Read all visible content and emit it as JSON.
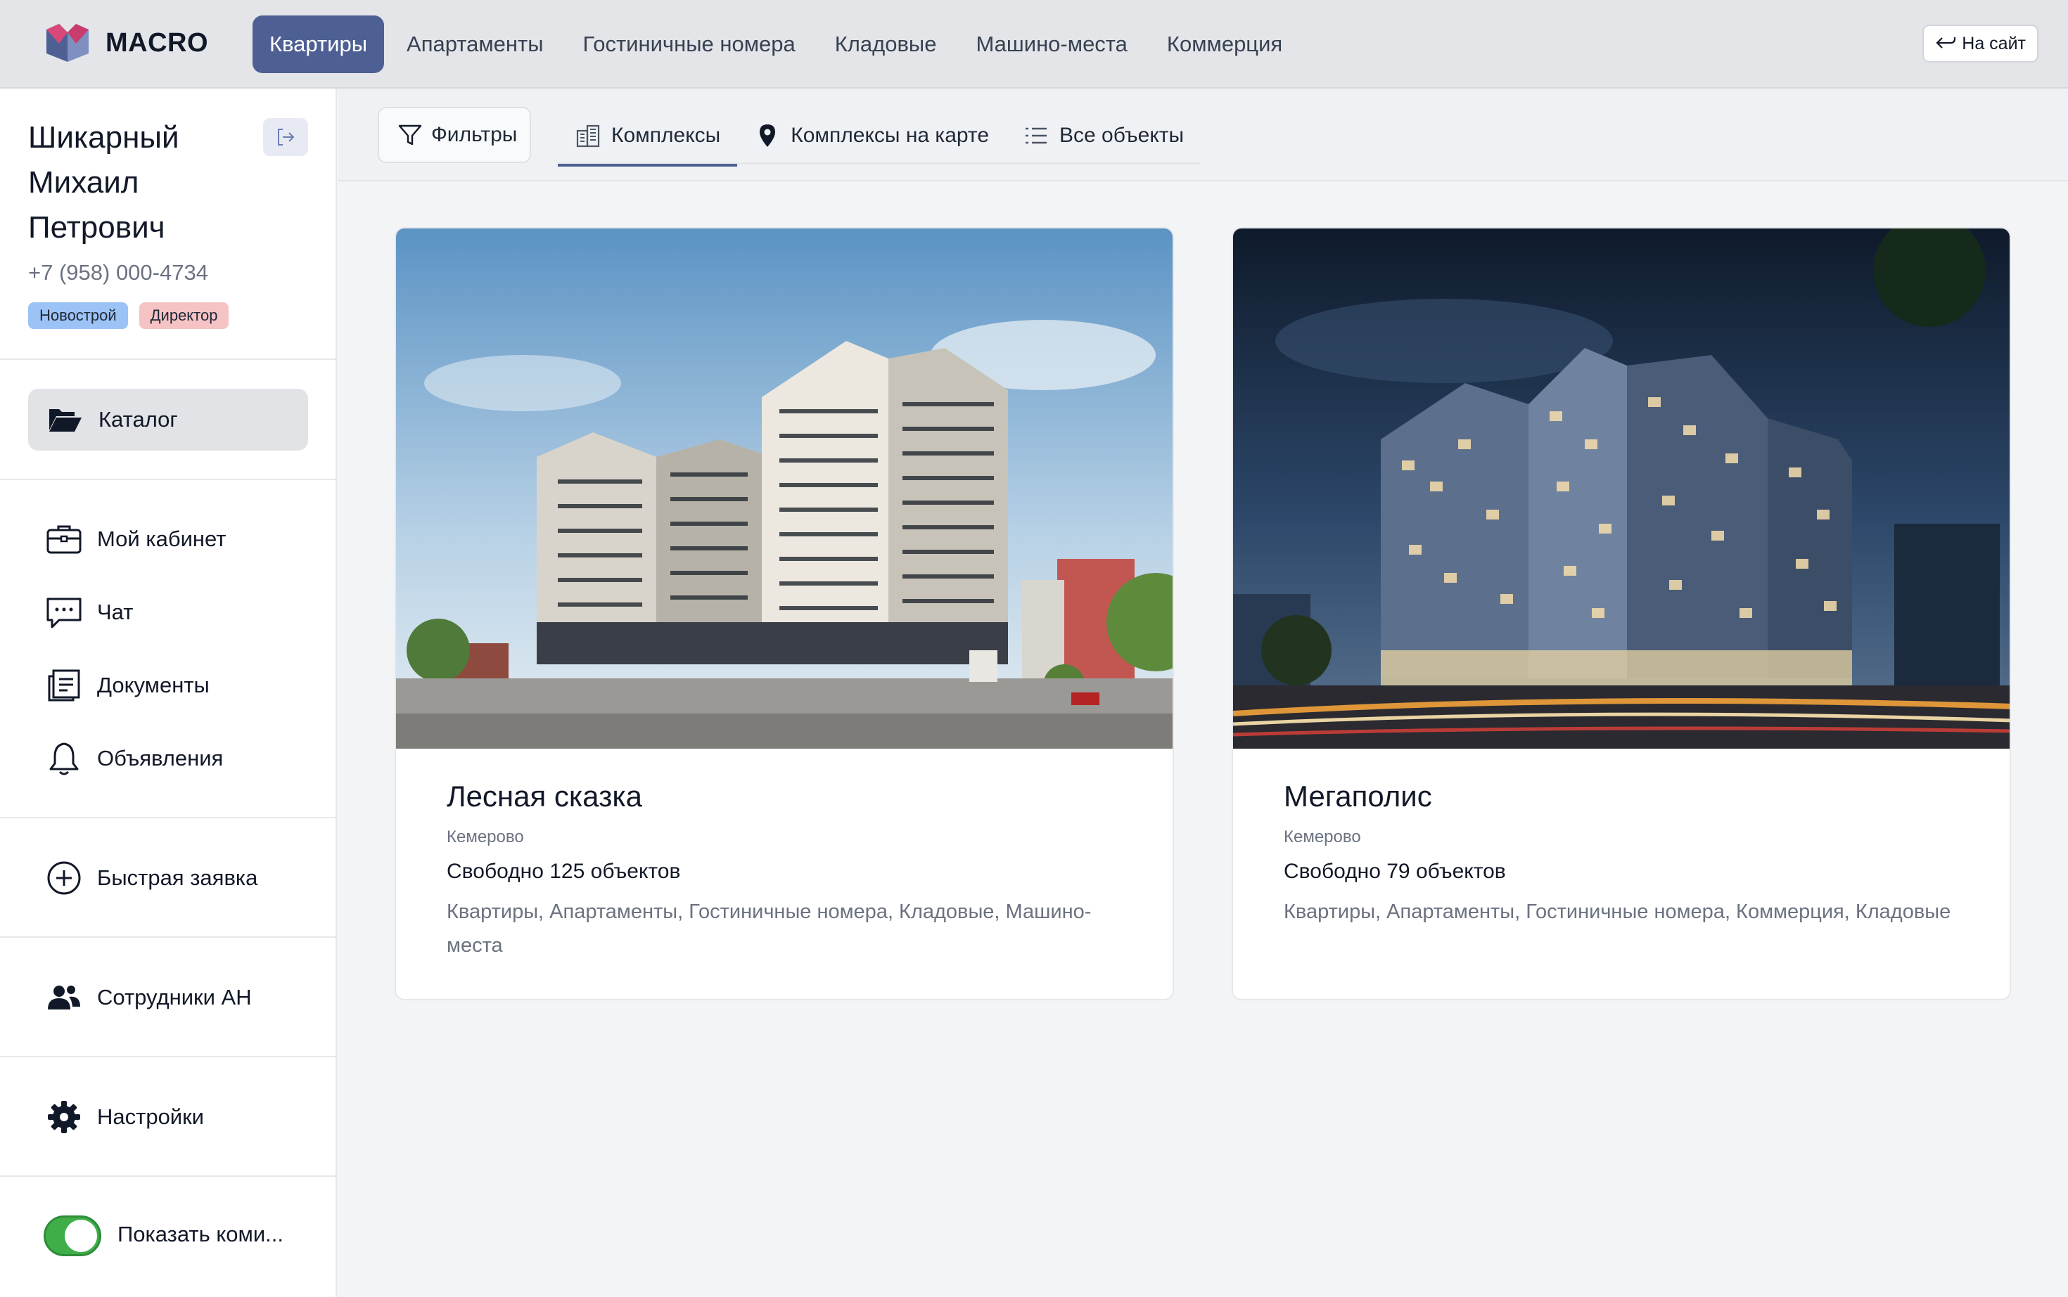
{
  "brand": {
    "name": "MACRO",
    "accent": "#4d5f93"
  },
  "topnav": {
    "items": [
      "Квартиры",
      "Апартаменты",
      "Гостиничные номера",
      "Кладовые",
      "Машино-места",
      "Коммерция"
    ],
    "active_index": 0,
    "to_site_label": "На сайт"
  },
  "user": {
    "name": "Шикарный Михаил Петрович",
    "phone": "+7 (958) 000-4734",
    "badges": [
      "Новострой",
      "Директор"
    ]
  },
  "sidebar": {
    "catalog": "Каталог",
    "cabinet": "Мой кабинет",
    "chat": "Чат",
    "documents": "Документы",
    "announcements": "Объявления",
    "quick_request": "Быстрая заявка",
    "staff": "Сотрудники АН",
    "settings": "Настройки",
    "toggle_label": "Показать коми...",
    "toggle_on": true
  },
  "subnav": {
    "filters": "Фильтры",
    "tabs": [
      "Комплексы",
      "Комплексы на карте",
      "Все объекты"
    ],
    "active_index": 0
  },
  "complexes": [
    {
      "title": "Лесная сказка",
      "city": "Кемерово",
      "free": "Свободно 125 объектов",
      "types": "Квартиры, Апартаменты, Гостиничные номера, Кладовые, Машино-места"
    },
    {
      "title": "Мегаполис",
      "city": "Кемерово",
      "free": "Свободно 79 объектов",
      "types": "Квартиры, Апартаменты, Гостиничные номера, Коммерция, Кладовые"
    }
  ]
}
